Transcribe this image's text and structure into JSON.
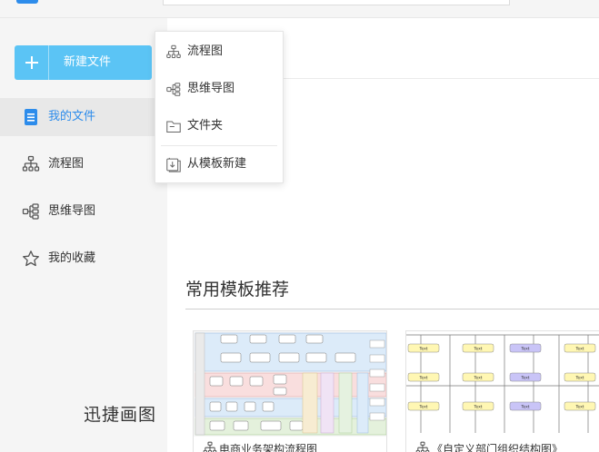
{
  "sidebar": {
    "new_button_label": "新建文件",
    "items": [
      {
        "label": "我的文件",
        "icon": "document-icon",
        "active": true
      },
      {
        "label": "流程图",
        "icon": "flowchart-icon"
      },
      {
        "label": "思维导图",
        "icon": "mindmap-icon"
      },
      {
        "label": "我的收藏",
        "icon": "star-icon"
      }
    ]
  },
  "brand": "迅捷画图",
  "dropdown": {
    "items": [
      {
        "label": "流程图",
        "icon": "flowchart-icon"
      },
      {
        "label": "思维导图",
        "icon": "mindmap-icon"
      },
      {
        "label": "文件夹",
        "icon": "folder-icon"
      },
      {
        "label": "从模板新建",
        "icon": "template-icon"
      }
    ]
  },
  "main": {
    "section_title": "常用模板推荐",
    "templates": [
      {
        "title": "电商业务架构流程图",
        "icon": "flowchart-icon"
      },
      {
        "title": "《自定义部门组织结构图》",
        "icon": "flowchart-icon"
      }
    ],
    "org_node_text": "Text"
  },
  "colors": {
    "accent": "#2d8ceb",
    "new_button": "#5bc4f5",
    "sidebar_bg": "#f5f5f5",
    "active_item_bg": "#e8e8e8",
    "org_node_yellow": "#fff7b3",
    "org_node_purple": "#c9c4f7"
  }
}
